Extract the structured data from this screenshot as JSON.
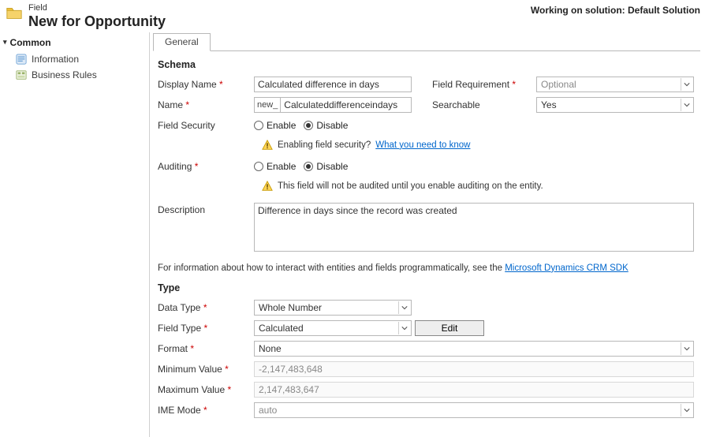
{
  "header": {
    "entity_label": "Field",
    "title": "New for Opportunity",
    "solution_label": "Working on solution: Default Solution"
  },
  "sidebar": {
    "header": "Common",
    "items": [
      {
        "label": "Information"
      },
      {
        "label": "Business Rules"
      }
    ]
  },
  "tabs": {
    "general": "General"
  },
  "sections": {
    "schema": "Schema",
    "type": "Type"
  },
  "labels": {
    "display_name": "Display Name",
    "name": "Name",
    "field_requirement": "Field Requirement",
    "searchable": "Searchable",
    "field_security": "Field Security",
    "auditing": "Auditing",
    "enable": "Enable",
    "disable": "Disable",
    "description": "Description",
    "data_type": "Data Type",
    "field_type": "Field Type",
    "format": "Format",
    "min_value": "Minimum Value",
    "max_value": "Maximum Value",
    "ime_mode": "IME Mode",
    "edit_button": "Edit"
  },
  "notes": {
    "security_prefix": "Enabling field security?",
    "security_link": "What you need to know",
    "auditing": "This field will not be audited until you enable auditing on the entity.",
    "sdk_prefix": "For information about how to interact with entities and fields programmatically, see the",
    "sdk_link": "Microsoft Dynamics CRM SDK"
  },
  "values": {
    "display_name": "Calculated difference in days",
    "name_prefix": "new_",
    "name": "Calculateddifferenceindays",
    "field_requirement": "Optional",
    "searchable": "Yes",
    "field_security": "disable",
    "auditing": "disable",
    "description": "Difference in days since the record was created",
    "data_type": "Whole Number",
    "field_type": "Calculated",
    "format": "None",
    "min_value": "-2,147,483,648",
    "max_value": "2,147,483,647",
    "ime_mode": "auto"
  }
}
